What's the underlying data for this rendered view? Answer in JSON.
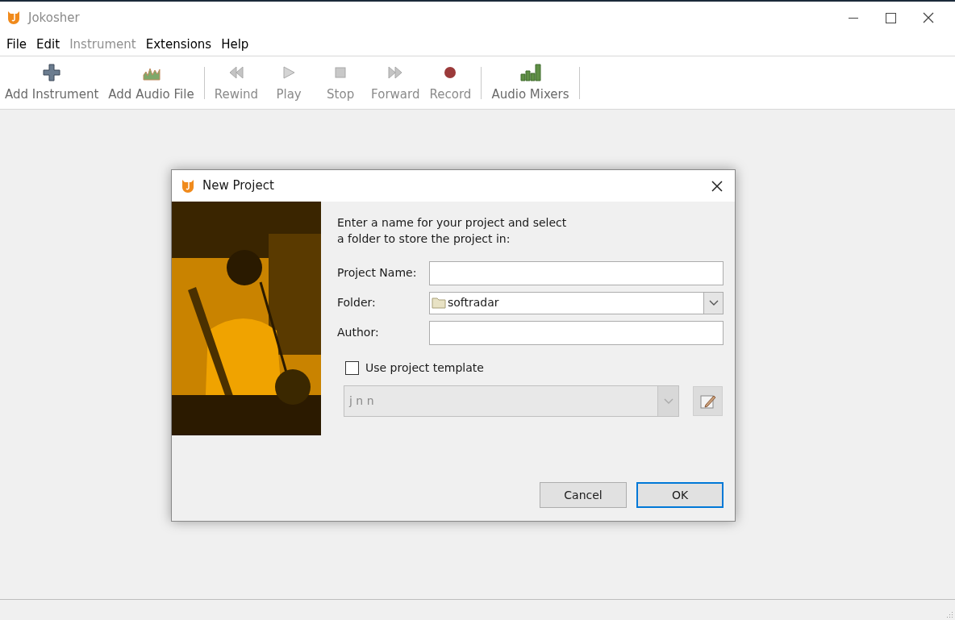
{
  "window": {
    "title": "Jokosher"
  },
  "menu": [
    {
      "label": "File",
      "disabled": false
    },
    {
      "label": "Edit",
      "disabled": false
    },
    {
      "label": "Instrument",
      "disabled": true
    },
    {
      "label": "Extensions",
      "disabled": false
    },
    {
      "label": "Help",
      "disabled": false
    }
  ],
  "toolbar": [
    {
      "kind": "add",
      "label": "Add Instrument",
      "disabled": false
    },
    {
      "kind": "audiofile",
      "label": "Add Audio File",
      "disabled": false
    },
    {
      "kind": "separator"
    },
    {
      "kind": "rewind",
      "label": "Rewind",
      "disabled": true
    },
    {
      "kind": "play",
      "label": "Play",
      "disabled": true
    },
    {
      "kind": "stop",
      "label": "Stop",
      "disabled": true
    },
    {
      "kind": "forward",
      "label": "Forward",
      "disabled": true
    },
    {
      "kind": "record",
      "label": "Record",
      "disabled": true
    },
    {
      "kind": "separator"
    },
    {
      "kind": "mixers",
      "label": "Audio Mixers",
      "disabled": false
    },
    {
      "kind": "separator"
    }
  ],
  "dialog": {
    "title": "New Project",
    "intro": [
      "Enter a name for your project and select",
      "a folder to store the project in:"
    ],
    "fields": [
      {
        "kind": "text",
        "label": "Project Name:"
      },
      {
        "kind": "folder",
        "label": "Folder:",
        "value": "softradar"
      },
      {
        "kind": "text",
        "label": "Author:"
      }
    ],
    "template_checkbox": {
      "label": "Use project template",
      "checked": false
    },
    "template_select": {
      "value": "j n n",
      "disabled": true
    },
    "buttons": [
      {
        "label": "Cancel",
        "default": false
      },
      {
        "label": "OK",
        "default": true
      }
    ]
  }
}
